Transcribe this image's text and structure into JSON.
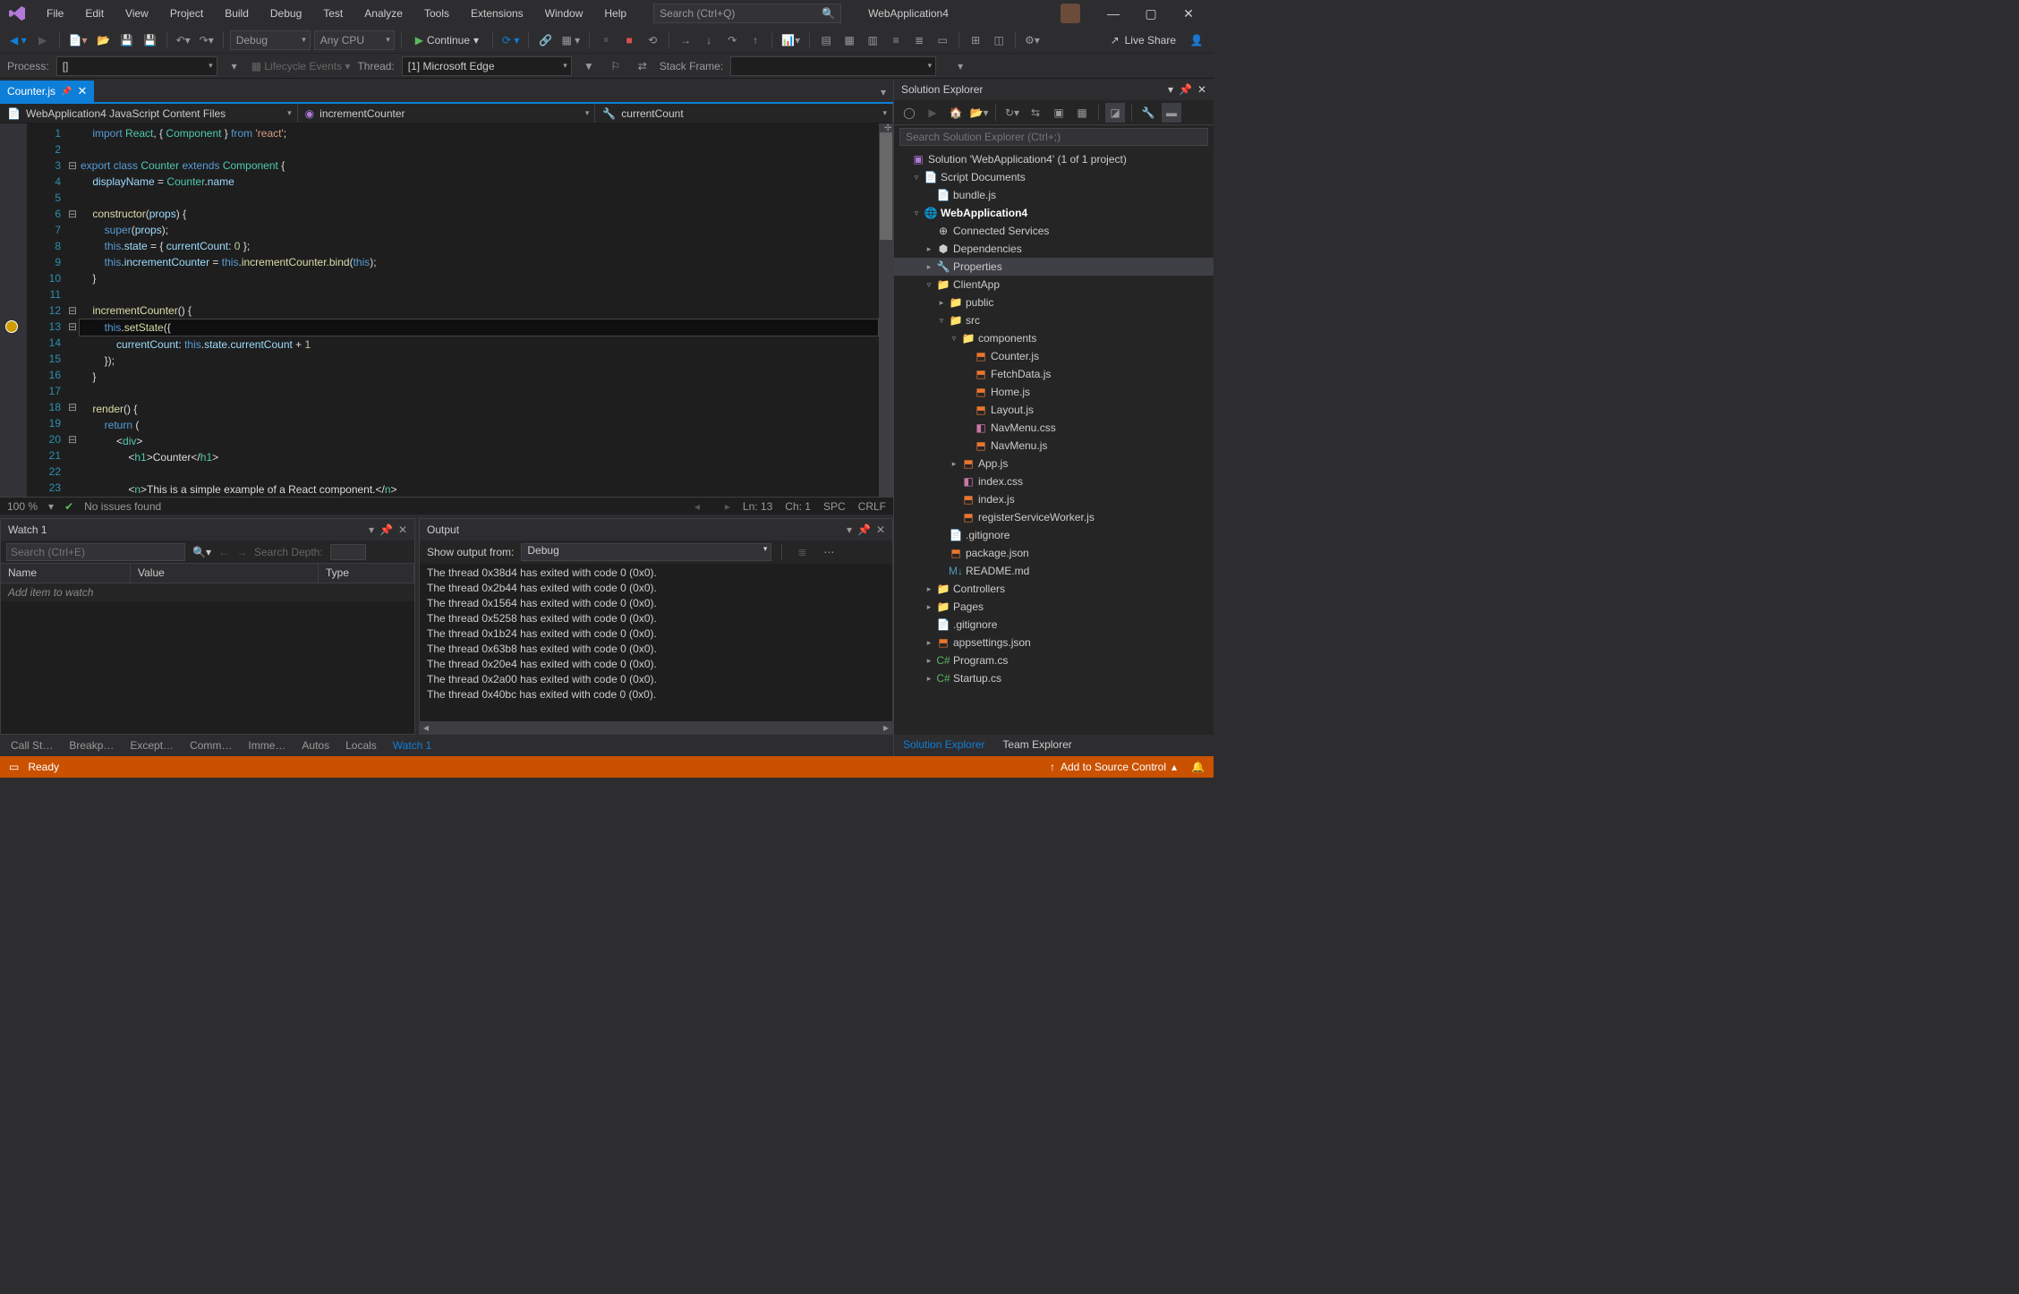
{
  "title": "WebApplication4",
  "menus": [
    "File",
    "Edit",
    "View",
    "Project",
    "Build",
    "Debug",
    "Test",
    "Analyze",
    "Tools",
    "Extensions",
    "Window",
    "Help"
  ],
  "search_placeholder": "Search (Ctrl+Q)",
  "toolbar": {
    "config": "Debug",
    "platform": "Any CPU",
    "continue": "Continue",
    "liveshare": "Live Share"
  },
  "toolbar2": {
    "process_label": "Process:",
    "process_value": "[]",
    "lifecycle": "Lifecycle Events",
    "thread_label": "Thread:",
    "thread_value": "[1] Microsoft Edge",
    "stackframe_label": "Stack Frame:"
  },
  "tab": {
    "name": "Counter.js"
  },
  "nav": {
    "scope": "WebApplication4 JavaScript Content Files",
    "member": "incrementCounter",
    "field": "currentCount"
  },
  "code_lines": [
    {
      "n": 1,
      "fold": "",
      "t": "    <span class='kw'>import</span> <span class='cls'>React</span>, { <span class='cls'>Component</span> } <span class='kw'>from</span> <span class='str'>'react'</span>;"
    },
    {
      "n": 2,
      "fold": "",
      "t": ""
    },
    {
      "n": 3,
      "fold": "⊟",
      "t": "<span class='kw'>export</span> <span class='kw'>class</span> <span class='cls'>Counter</span> <span class='kw'>extends</span> <span class='cls'>Component</span> {"
    },
    {
      "n": 4,
      "fold": "",
      "t": "    <span class='prop'>displayName</span> = <span class='cls'>Counter</span>.<span class='prop'>name</span>"
    },
    {
      "n": 5,
      "fold": "",
      "t": ""
    },
    {
      "n": 6,
      "fold": "⊟",
      "t": "    <span class='fn'>constructor</span>(<span class='prop'>props</span>) {"
    },
    {
      "n": 7,
      "fold": "",
      "t": "        <span class='kw'>super</span>(<span class='prop'>props</span>);"
    },
    {
      "n": 8,
      "fold": "",
      "t": "        <span class='kw'>this</span>.<span class='prop'>state</span> = { <span class='prop'>currentCount</span>: <span class='num'>0</span> };"
    },
    {
      "n": 9,
      "fold": "",
      "t": "        <span class='kw'>this</span>.<span class='prop'>incrementCounter</span> = <span class='kw'>this</span>.<span class='fn'>incrementCounter</span>.<span class='fn'>bind</span>(<span class='kw'>this</span>);"
    },
    {
      "n": 10,
      "fold": "",
      "t": "    }"
    },
    {
      "n": 11,
      "fold": "",
      "t": ""
    },
    {
      "n": 12,
      "fold": "⊟",
      "t": "    <span class='fn'>incrementCounter</span>() {"
    },
    {
      "n": 13,
      "fold": "⊟",
      "t": "        <span class='kw'>this</span>.<span class='fn'>setState</span>({",
      "cur": true,
      "bp": true
    },
    {
      "n": 14,
      "fold": "",
      "t": "            <span class='prop'>currentCount</span>: <span class='kw'>this</span>.<span class='prop'>state</span>.<span class='prop'>currentCount</span> + <span class='num'>1</span>"
    },
    {
      "n": 15,
      "fold": "",
      "t": "        });"
    },
    {
      "n": 16,
      "fold": "",
      "t": "    }"
    },
    {
      "n": 17,
      "fold": "",
      "t": ""
    },
    {
      "n": 18,
      "fold": "⊟",
      "t": "    <span class='fn'>render</span>() {"
    },
    {
      "n": 19,
      "fold": "",
      "t": "        <span class='kw'>return</span> ("
    },
    {
      "n": 20,
      "fold": "⊟",
      "t": "            &lt;<span class='cls'>div</span>&gt;"
    },
    {
      "n": 21,
      "fold": "",
      "t": "                &lt;<span class='cls'>h1</span>&gt;Counter&lt;/<span class='cls'>h1</span>&gt;"
    },
    {
      "n": 22,
      "fold": "",
      "t": ""
    },
    {
      "n": 23,
      "fold": "",
      "t": "                &lt;<span class='cls'>n</span>&gt;This is a simple example of a React component.&lt;/<span class='cls'>n</span>&gt;"
    }
  ],
  "status": {
    "zoom": "100 %",
    "issues": "No issues found",
    "ln": "Ln: 13",
    "ch": "Ch: 1",
    "spc": "SPC",
    "crlf": "CRLF"
  },
  "watch": {
    "title": "Watch 1",
    "search_placeholder": "Search (Ctrl+E)",
    "depth_label": "Search Depth:",
    "cols": [
      "Name",
      "Value",
      "Type"
    ],
    "add": "Add item to watch"
  },
  "output": {
    "title": "Output",
    "show_label": "Show output from:",
    "source": "Debug",
    "lines": [
      "The thread 0x38d4 has exited with code 0 (0x0).",
      "The thread 0x2b44 has exited with code 0 (0x0).",
      "The thread 0x1564 has exited with code 0 (0x0).",
      "The thread 0x5258 has exited with code 0 (0x0).",
      "The thread 0x1b24 has exited with code 0 (0x0).",
      "The thread 0x63b8 has exited with code 0 (0x0).",
      "The thread 0x20e4 has exited with code 0 (0x0).",
      "The thread 0x2a00 has exited with code 0 (0x0).",
      "The thread 0x40bc has exited with code 0 (0x0)."
    ]
  },
  "bottom_tabs": [
    "Call St…",
    "Breakp…",
    "Except…",
    "Comm…",
    "Imme…",
    "Autos",
    "Locals",
    "Watch 1"
  ],
  "solution": {
    "title": "Solution Explorer",
    "search_placeholder": "Search Solution Explorer (Ctrl+;)",
    "root": "Solution 'WebApplication4' (1 of 1 project)",
    "tree": [
      {
        "d": 1,
        "e": "▿",
        "i": "📄",
        "c": "ic-orange",
        "t": "Script Documents"
      },
      {
        "d": 2,
        "e": "",
        "i": "📄",
        "c": "ic-js",
        "t": "bundle.js"
      },
      {
        "d": 1,
        "e": "▿",
        "i": "🌐",
        "c": "",
        "t": "WebApplication4",
        "bold": true
      },
      {
        "d": 2,
        "e": "",
        "i": "⊕",
        "c": "",
        "t": "Connected Services"
      },
      {
        "d": 2,
        "e": "▸",
        "i": "⬢",
        "c": "",
        "t": "Dependencies"
      },
      {
        "d": 2,
        "e": "▸",
        "i": "🔧",
        "c": "",
        "t": "Properties",
        "sel": true
      },
      {
        "d": 2,
        "e": "▿",
        "i": "📁",
        "c": "ic-folder",
        "t": "ClientApp"
      },
      {
        "d": 3,
        "e": "▸",
        "i": "📁",
        "c": "ic-folder",
        "t": "public"
      },
      {
        "d": 3,
        "e": "▿",
        "i": "📁",
        "c": "ic-folder",
        "t": "src"
      },
      {
        "d": 4,
        "e": "▿",
        "i": "📁",
        "c": "ic-folder",
        "t": "components"
      },
      {
        "d": 5,
        "e": "",
        "i": "⬒",
        "c": "ic-js",
        "t": "Counter.js"
      },
      {
        "d": 5,
        "e": "",
        "i": "⬒",
        "c": "ic-js",
        "t": "FetchData.js"
      },
      {
        "d": 5,
        "e": "",
        "i": "⬒",
        "c": "ic-js",
        "t": "Home.js"
      },
      {
        "d": 5,
        "e": "",
        "i": "⬒",
        "c": "ic-js",
        "t": "Layout.js"
      },
      {
        "d": 5,
        "e": "",
        "i": "◧",
        "c": "ic-css",
        "t": "NavMenu.css"
      },
      {
        "d": 5,
        "e": "",
        "i": "⬒",
        "c": "ic-js",
        "t": "NavMenu.js"
      },
      {
        "d": 4,
        "e": "▸",
        "i": "⬒",
        "c": "ic-js",
        "t": "App.js"
      },
      {
        "d": 4,
        "e": "",
        "i": "◧",
        "c": "ic-css",
        "t": "index.css"
      },
      {
        "d": 4,
        "e": "",
        "i": "⬒",
        "c": "ic-js",
        "t": "index.js"
      },
      {
        "d": 4,
        "e": "",
        "i": "⬒",
        "c": "ic-js",
        "t": "registerServiceWorker.js"
      },
      {
        "d": 3,
        "e": "",
        "i": "📄",
        "c": "",
        "t": ".gitignore"
      },
      {
        "d": 3,
        "e": "",
        "i": "⬒",
        "c": "ic-js",
        "t": "package.json"
      },
      {
        "d": 3,
        "e": "",
        "i": "M↓",
        "c": "ic-md",
        "t": "README.md"
      },
      {
        "d": 2,
        "e": "▸",
        "i": "📁",
        "c": "ic-folder",
        "t": "Controllers"
      },
      {
        "d": 2,
        "e": "▸",
        "i": "📁",
        "c": "ic-folder",
        "t": "Pages"
      },
      {
        "d": 2,
        "e": "",
        "i": "📄",
        "c": "",
        "t": ".gitignore"
      },
      {
        "d": 2,
        "e": "▸",
        "i": "⬒",
        "c": "ic-js",
        "t": "appsettings.json"
      },
      {
        "d": 2,
        "e": "▸",
        "i": "C#",
        "c": "ic-cs",
        "t": "Program.cs"
      },
      {
        "d": 2,
        "e": "▸",
        "i": "C#",
        "c": "ic-cs",
        "t": "Startup.cs"
      }
    ]
  },
  "side_tabs": [
    "Solution Explorer",
    "Team Explorer"
  ],
  "statusbar": {
    "ready": "Ready",
    "source": "Add to Source Control"
  }
}
